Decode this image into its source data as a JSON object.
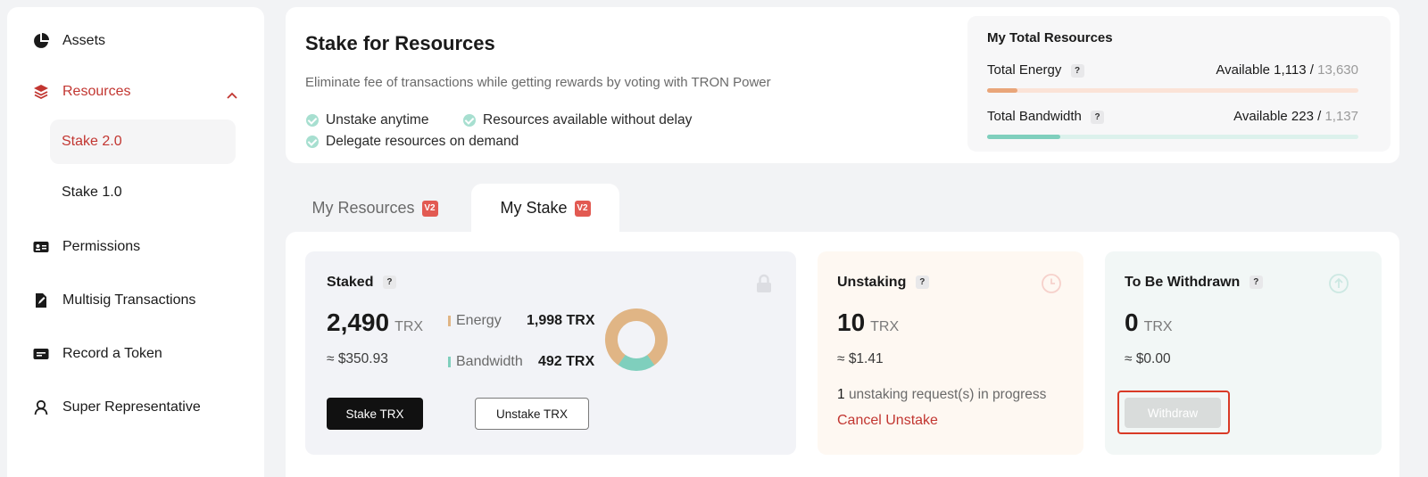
{
  "sidebar": {
    "items": [
      {
        "label": "Assets",
        "icon": "pie-chart-icon"
      },
      {
        "label": "Resources",
        "icon": "layers-icon"
      },
      {
        "label": "Permissions",
        "icon": "id-card-icon"
      },
      {
        "label": "Multisig Transactions",
        "icon": "document-edit-icon"
      },
      {
        "label": "Record a Token",
        "icon": "token-card-icon"
      },
      {
        "label": "Super Representative",
        "icon": "person-icon"
      }
    ],
    "subitems": [
      {
        "label": "Stake 2.0"
      },
      {
        "label": "Stake 1.0"
      }
    ]
  },
  "header": {
    "title": "Stake for Resources",
    "subtitle": "Eliminate fee of transactions while getting rewards by voting with TRON Power",
    "features": [
      "Unstake anytime",
      "Resources available without delay",
      "Delegate resources on demand"
    ]
  },
  "total_resources": {
    "title": "My Total Resources",
    "energy": {
      "label": "Total Energy",
      "qmark": "?",
      "available_label": "Available 1,113",
      "slash": "/",
      "total": "13,630",
      "ratio": 0.082,
      "color": "#e9a67a",
      "track": "#fbe3d7"
    },
    "bandwidth": {
      "label": "Total Bandwidth",
      "qmark": "?",
      "available_label": "Available 223",
      "slash": "/",
      "total": "1,137",
      "ratio": 0.196,
      "color": "#7fcfbd",
      "track": "#dcf1ec"
    }
  },
  "tabs": [
    {
      "label": "My Resources",
      "badge": "V2"
    },
    {
      "label": "My Stake",
      "badge": "V2"
    }
  ],
  "staked": {
    "title": "Staked",
    "qmark": "?",
    "amount": "2,490",
    "unit": "TRX",
    "approx": "≈ $350.93",
    "energy_label": "Energy",
    "energy_value": "1,998 TRX",
    "bandwidth_label": "Bandwidth",
    "bandwidth_value": "492 TRX",
    "stake_button": "Stake TRX",
    "unstake_button": "Unstake TRX",
    "energy_color": "#e0b585",
    "bandwidth_color": "#7fcfbd"
  },
  "unstaking": {
    "title": "Unstaking",
    "qmark": "?",
    "amount": "10",
    "unit": "TRX",
    "approx": "≈ $1.41",
    "request_count": "1",
    "request_text": "unstaking request(s) in progress",
    "cancel_link": "Cancel Unstake"
  },
  "withdraw": {
    "title": "To Be Withdrawn",
    "qmark": "?",
    "amount": "0",
    "unit": "TRX",
    "approx": "≈ $0.00",
    "button": "Withdraw"
  }
}
